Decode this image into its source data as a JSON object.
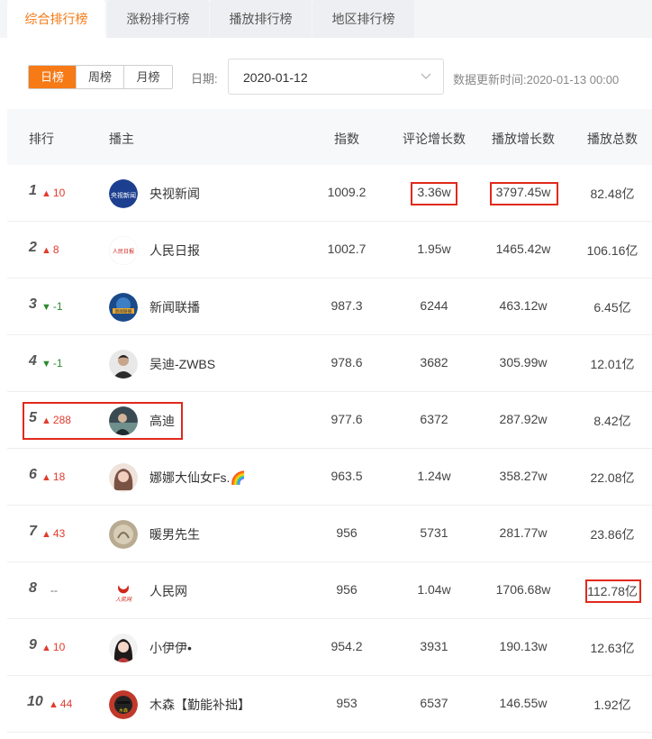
{
  "tabs": [
    {
      "label": "综合排行榜",
      "active": true
    },
    {
      "label": "涨粉排行榜",
      "active": false
    },
    {
      "label": "播放排行榜",
      "active": false
    },
    {
      "label": "地区排行榜",
      "active": false
    }
  ],
  "period": {
    "options": [
      "日榜",
      "周榜",
      "月榜"
    ],
    "selected": "日榜"
  },
  "date": {
    "label": "日期:",
    "value": "2020-01-12"
  },
  "update_time": "数据更新时间:2020-01-13 00:00",
  "table": {
    "headers": {
      "rank": "排行",
      "host": "播主",
      "index": "指数",
      "comment_growth": "评论增长数",
      "play_growth": "播放增长数",
      "play_total": "播放总数"
    },
    "rows": [
      {
        "rank": "1",
        "change": "10",
        "dir": "up",
        "name": "央视新闻",
        "index": "1009.2",
        "comment": "3.36w",
        "play": "3797.45w",
        "total": "82.48亿"
      },
      {
        "rank": "2",
        "change": "8",
        "dir": "up",
        "name": "人民日报",
        "index": "1002.7",
        "comment": "1.95w",
        "play": "1465.42w",
        "total": "106.16亿"
      },
      {
        "rank": "3",
        "change": "-1",
        "dir": "down",
        "name": "新闻联播",
        "index": "987.3",
        "comment": "6244",
        "play": "463.12w",
        "total": "6.45亿"
      },
      {
        "rank": "4",
        "change": "-1",
        "dir": "down",
        "name": "吴迪-ZWBS",
        "index": "978.6",
        "comment": "3682",
        "play": "305.99w",
        "total": "12.01亿"
      },
      {
        "rank": "5",
        "change": "288",
        "dir": "up",
        "name": "高迪",
        "index": "977.6",
        "comment": "6372",
        "play": "287.92w",
        "total": "8.42亿"
      },
      {
        "rank": "6",
        "change": "18",
        "dir": "up",
        "name": "娜娜大仙女Fs.🌈",
        "index": "963.5",
        "comment": "1.24w",
        "play": "358.27w",
        "total": "22.08亿"
      },
      {
        "rank": "7",
        "change": "43",
        "dir": "up",
        "name": "暖男先生",
        "index": "956",
        "comment": "5731",
        "play": "281.77w",
        "total": "23.86亿"
      },
      {
        "rank": "8",
        "change": "--",
        "dir": "flat",
        "name": "人民网",
        "index": "956",
        "comment": "1.04w",
        "play": "1706.68w",
        "total": "112.78亿"
      },
      {
        "rank": "9",
        "change": "10",
        "dir": "up",
        "name": "小伊伊•",
        "index": "954.2",
        "comment": "3931",
        "play": "190.13w",
        "total": "12.63亿"
      },
      {
        "rank": "10",
        "change": "44",
        "dir": "up",
        "name": "木森【勤能补拙】",
        "index": "953",
        "comment": "6537",
        "play": "146.55w",
        "total": "1.92亿"
      }
    ]
  },
  "avatars": {
    "r1_text": "央视新闻",
    "r2_text": "人民日报",
    "r3_text": "新闻联播",
    "r8_text": "人民网",
    "r10_text": "木森"
  },
  "colors": {
    "accent": "#f67a16",
    "up": "#e23b2d",
    "down": "#2a8a2e",
    "highlight": "#e0291c"
  }
}
